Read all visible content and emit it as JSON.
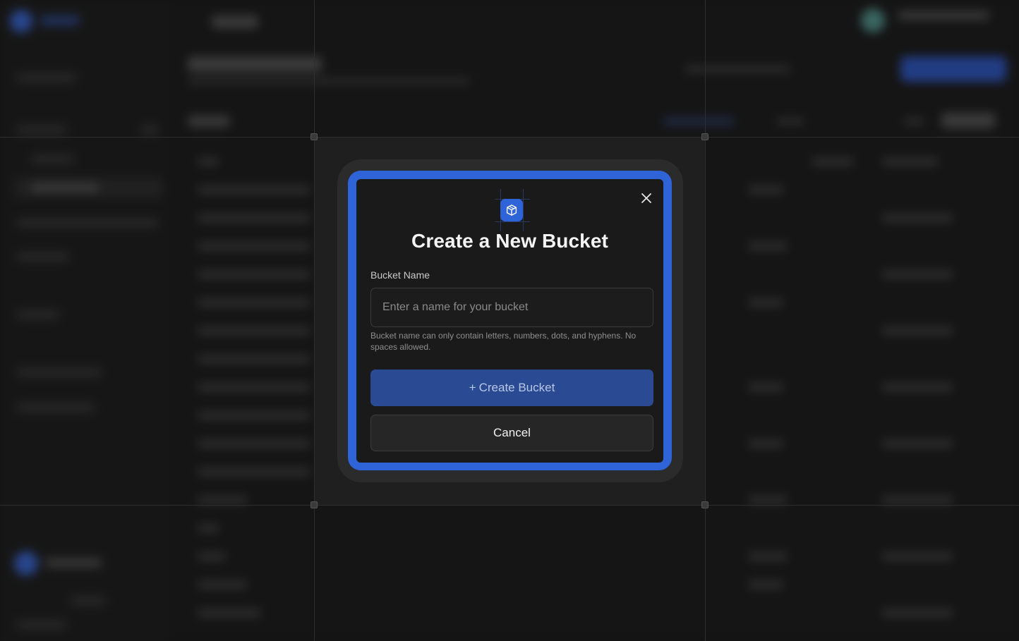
{
  "modal": {
    "title": "Create a New Bucket",
    "icon": "cube-icon",
    "close_icon": "close-icon",
    "field_label": "Bucket Name",
    "input_value": "",
    "input_placeholder": "Enter a name for your bucket",
    "hint": "Bucket name can only contain letters, numbers, dots, and hyphens. No spaces allowed.",
    "create_button_prefix": "+",
    "create_button_label": "Create Bucket",
    "cancel_button_label": "Cancel"
  },
  "colors": {
    "accent": "#2f63d8",
    "create_button_bg": "#2a4a94",
    "modal_bg": "#1a1a1a",
    "page_bg": "#141414"
  }
}
